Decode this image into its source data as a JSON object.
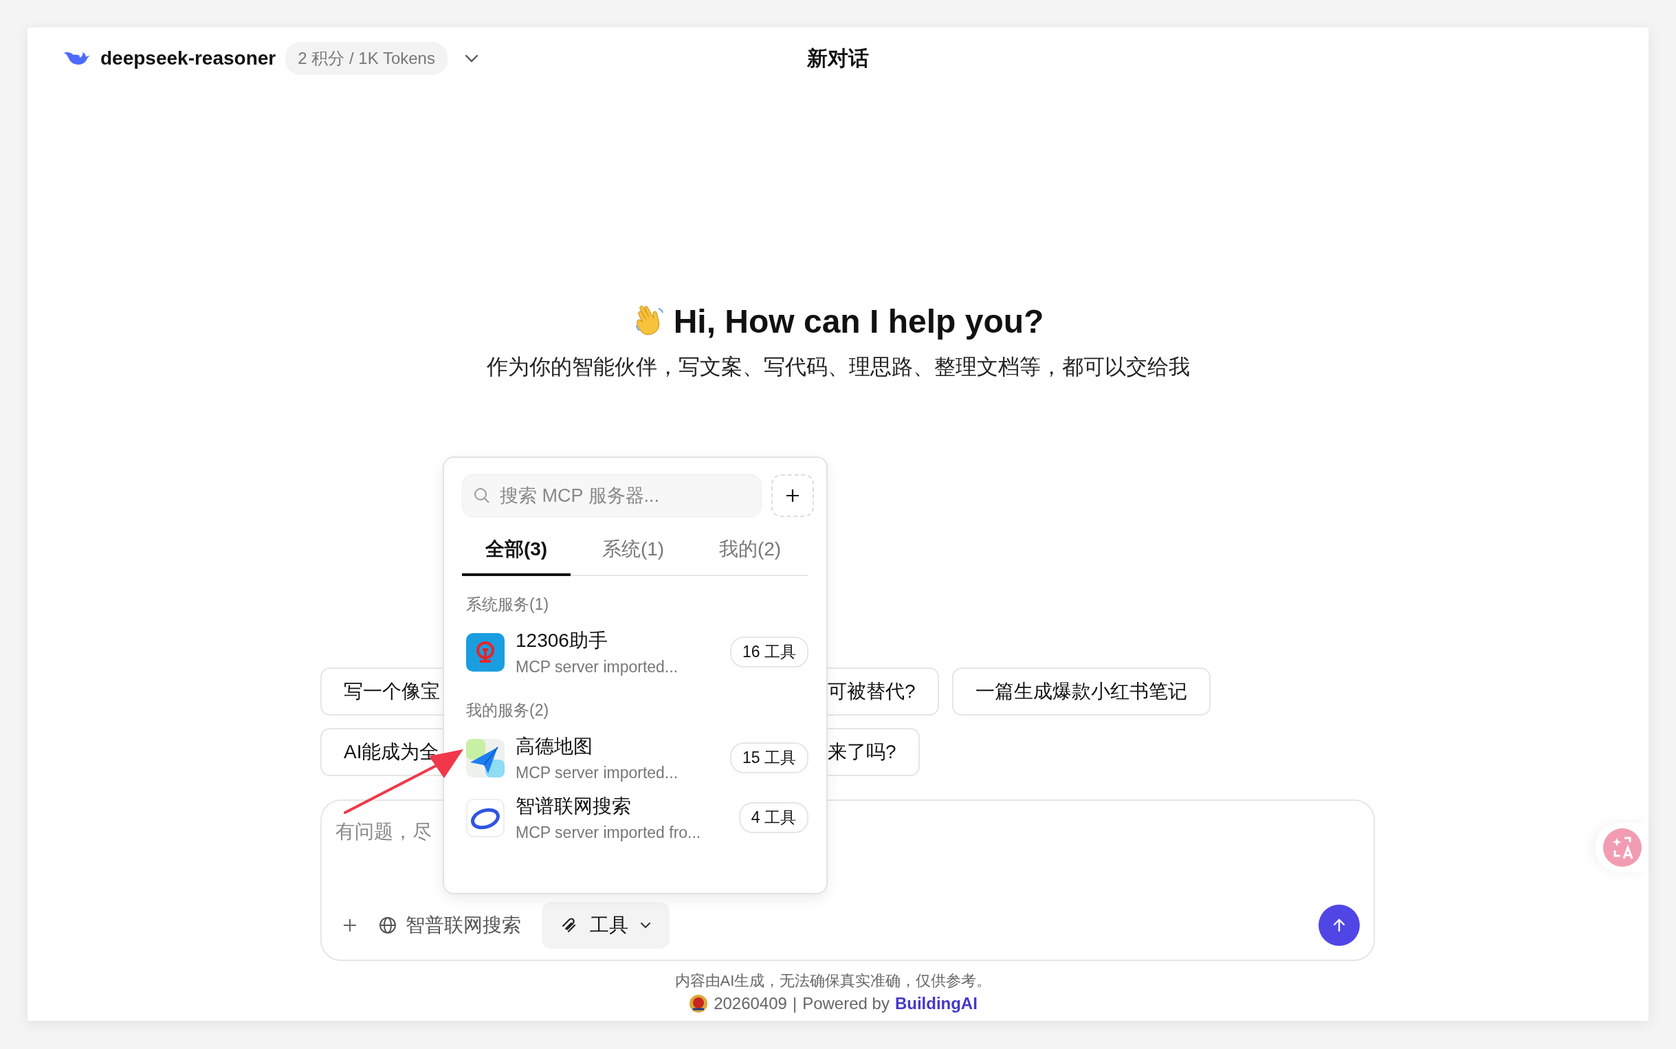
{
  "header": {
    "model": "deepseek-reasoner",
    "price": "2 积分 / 1K Tokens",
    "title": "新对话"
  },
  "greeting": {
    "title": "Hi, How can I help you?",
    "subtitle": "作为你的智能伙伴，写文案、写代码、理思路、整理文档等，都可以交给我"
  },
  "suggestions": [
    [
      {
        "kind": "split",
        "text_start": "写一个像宝",
        "text_end": "可被替代?"
      },
      {
        "kind": "whole",
        "text": "一篇生成爆款小红书笔记"
      }
    ],
    [
      {
        "kind": "split",
        "text_start": "AI能成为全",
        "text_end": "来了吗?"
      }
    ]
  ],
  "composer": {
    "placeholder": "有问题，尽",
    "web_search": "智普联网搜索",
    "tools_button": "工具"
  },
  "mcp_popup": {
    "placeholder": "搜索 MCP 服务器...",
    "tabs": [
      {
        "label": "全部(3)",
        "selected": true
      },
      {
        "label": "系统(1)",
        "selected": false
      },
      {
        "label": "我的(2)",
        "selected": false
      }
    ],
    "sections": [
      {
        "title": "系统服务(1)",
        "items": [
          {
            "name": "12306助手",
            "description": "MCP server imported...",
            "tools": "16 工具"
          }
        ]
      },
      {
        "title": "我的服务(2)",
        "items": [
          {
            "name": "高德地图",
            "description": "MCP server imported...",
            "tools": "15 工具"
          },
          {
            "name": "智谱联网搜索",
            "description": "MCP server imported fro...",
            "tools": "4 工具"
          }
        ]
      }
    ]
  },
  "footer": {
    "disclaimer": "内容由AI生成，无法确保真实准确，仅供参考。",
    "record": "20260409",
    "separator": "|",
    "powered": "Powered by",
    "brand": "BuildingAI"
  }
}
